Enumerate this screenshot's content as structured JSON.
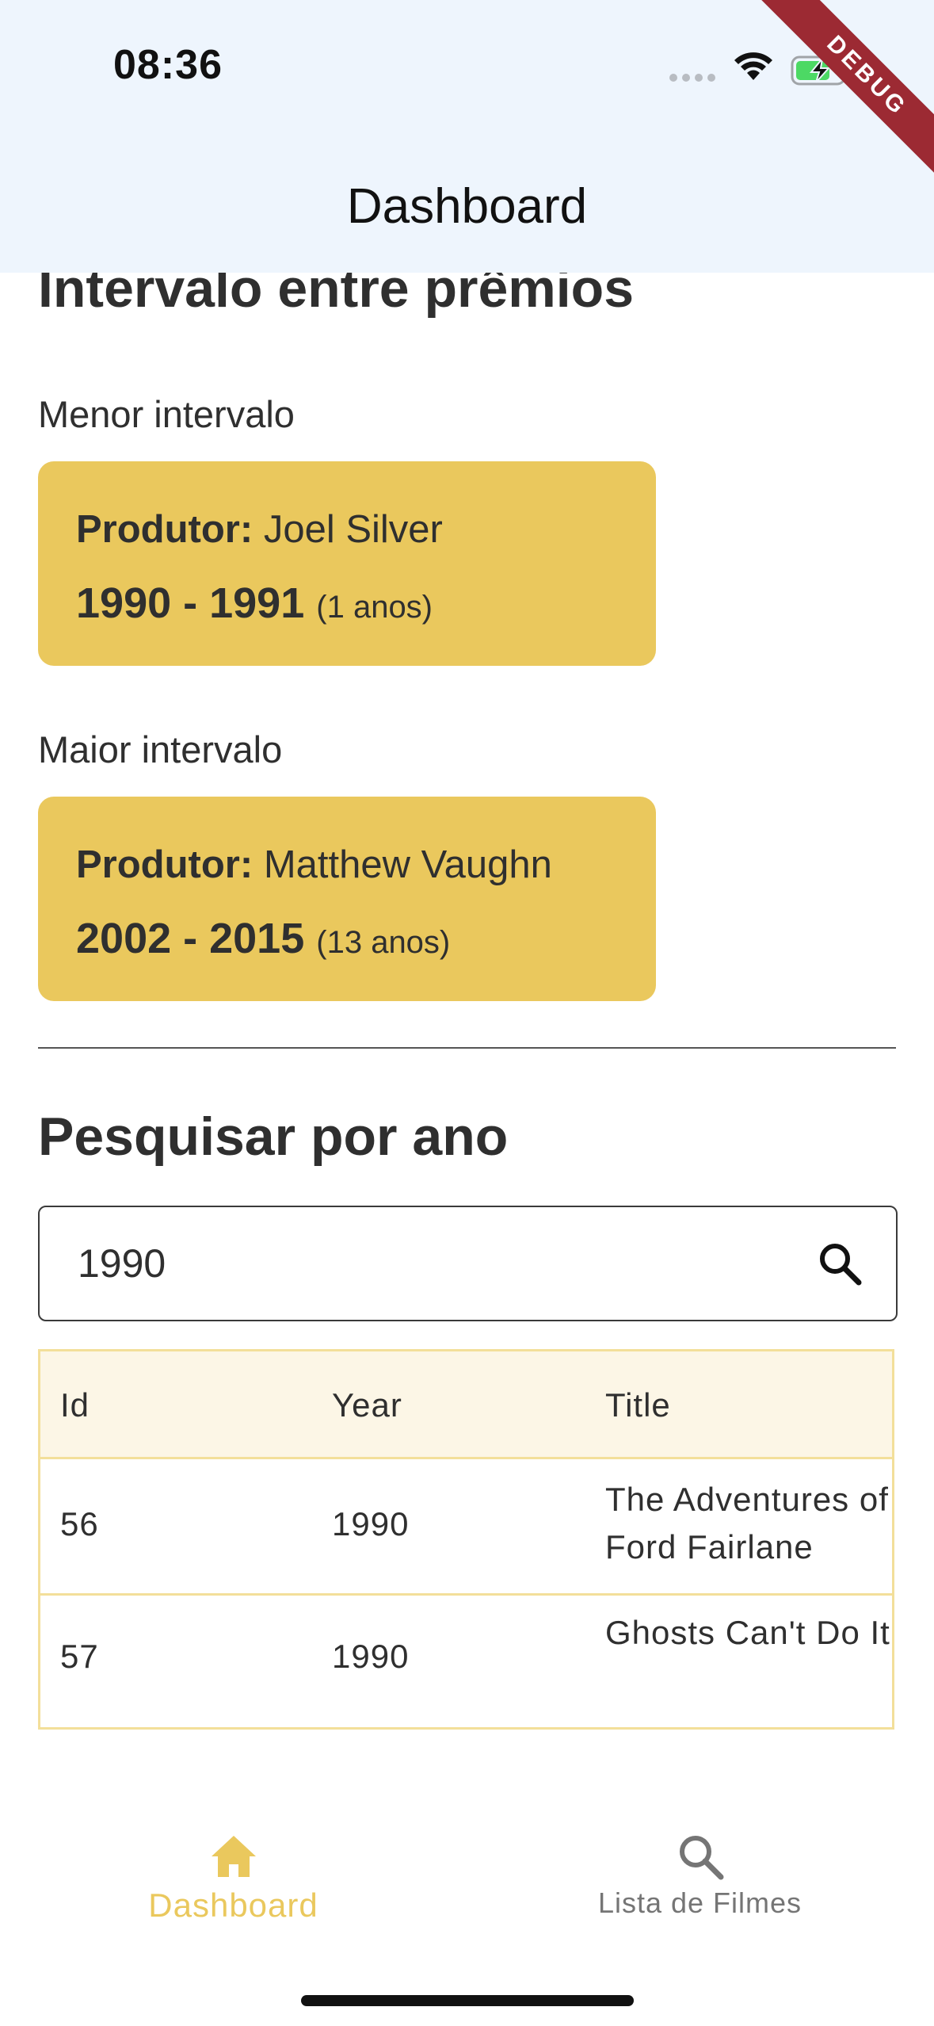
{
  "status_bar": {
    "time": "08:36"
  },
  "debug_banner": "DEBUG",
  "app_bar": {
    "title": "Dashboard"
  },
  "awards_interval": {
    "title": "Intervalo entre prêmios",
    "min": {
      "label": "Menor intervalo",
      "producer_label": "Produtor:",
      "producer": "Joel Silver",
      "years": "1990 - 1991",
      "duration": "(1 anos)"
    },
    "max": {
      "label": "Maior intervalo",
      "producer_label": "Produtor:",
      "producer": "Matthew Vaughn",
      "years": "2002 - 2015",
      "duration": "(13 anos)"
    }
  },
  "search_by_year": {
    "title": "Pesquisar por ano",
    "input_value": "1990",
    "table": {
      "columns": [
        "Id",
        "Year",
        "Title"
      ],
      "rows": [
        {
          "id": "56",
          "year": "1990",
          "title": "The Adventures of Ford Fairlane"
        },
        {
          "id": "57",
          "year": "1990",
          "title": "Ghosts Can't Do It"
        }
      ]
    }
  },
  "bottom_nav": {
    "items": [
      {
        "label": "Dashboard",
        "icon": "home-icon",
        "active": true
      },
      {
        "label": "Lista de Filmes",
        "icon": "search-icon",
        "active": false
      }
    ]
  },
  "colors": {
    "accent": "#eac85d",
    "app_bar_bg": "#eef5fd",
    "table_border": "#f3df9a",
    "table_header_bg": "#fcf6e6",
    "inactive_nav": "#757575",
    "debug_banner": "#9c2a33"
  }
}
